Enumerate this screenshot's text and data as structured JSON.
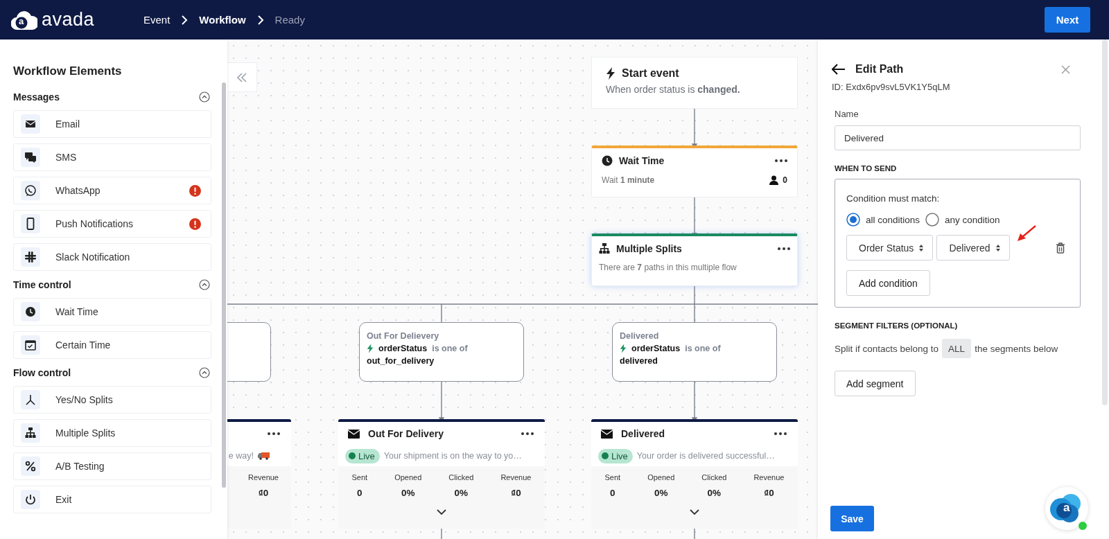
{
  "header": {
    "brand": "avada",
    "logo_letter": "a",
    "breadcrumb": [
      {
        "label": "Event",
        "selected": false,
        "disabled": false
      },
      {
        "label": "Workflow",
        "selected": true,
        "disabled": false
      },
      {
        "label": "Ready",
        "selected": false,
        "disabled": true
      }
    ],
    "next_button": "Next"
  },
  "sidebar": {
    "title": "Workflow Elements",
    "sections": [
      {
        "title": "Messages",
        "expanded": true,
        "items": [
          {
            "label": "Email",
            "kind": "email",
            "warning": false
          },
          {
            "label": "SMS",
            "kind": "sms",
            "warning": false
          },
          {
            "label": "WhatsApp",
            "kind": "whatsapp",
            "warning": true
          },
          {
            "label": "Push Notifications",
            "kind": "push",
            "warning": true
          },
          {
            "label": "Slack Notification",
            "kind": "slack",
            "warning": false
          }
        ]
      },
      {
        "title": "Time control",
        "expanded": true,
        "items": [
          {
            "label": "Wait Time",
            "kind": "wait",
            "warning": false
          },
          {
            "label": "Certain Time",
            "kind": "certain",
            "warning": false
          }
        ]
      },
      {
        "title": "Flow control",
        "expanded": true,
        "items": [
          {
            "label": "Yes/No Splits",
            "kind": "yesno",
            "warning": false
          },
          {
            "label": "Multiple Splits",
            "kind": "multi",
            "warning": false
          },
          {
            "label": "A/B Testing",
            "kind": "ab",
            "warning": false
          },
          {
            "label": "Exit",
            "kind": "exit",
            "warning": false
          }
        ]
      }
    ]
  },
  "canvas": {
    "start": {
      "title": "Start event",
      "text": "When order status is **changed.**"
    },
    "wait": {
      "title": "Wait Time",
      "text": "Wait **1 minute**",
      "count": "0"
    },
    "split": {
      "title": "Multiple Splits",
      "text": "There are **7** paths in this multiple flow"
    },
    "paths": [
      {
        "name": "Out For Delievery",
        "field": "orderStatus",
        "operator": "is one of",
        "value": "out_for_delivery"
      },
      {
        "name": "Delivered",
        "field": "orderStatus",
        "operator": "is one of",
        "value": "delivered"
      }
    ],
    "cut_message": {
      "preview": "e way!",
      "stats": [
        {
          "label": "Revenue",
          "value": "₫0"
        }
      ]
    },
    "messages": [
      {
        "title": "Out For Delivery",
        "status": "Live",
        "live": true,
        "preview": "Your shipment is on the way to yo…",
        "stats": [
          {
            "label": "Sent",
            "value": "0"
          },
          {
            "label": "Opened",
            "value": "0%"
          },
          {
            "label": "Clicked",
            "value": "0%"
          },
          {
            "label": "Revenue",
            "value": "₫0"
          }
        ]
      },
      {
        "title": "Delivered",
        "status": "Live",
        "live": true,
        "preview": "Your order is delivered successful…",
        "stats": [
          {
            "label": "Sent",
            "value": "0"
          },
          {
            "label": "Opened",
            "value": "0%"
          },
          {
            "label": "Clicked",
            "value": "0%"
          },
          {
            "label": "Revenue",
            "value": "₫0"
          }
        ]
      }
    ]
  },
  "panel": {
    "title": "Edit Path",
    "id_text": "ID: Exdx6pv9svL5VK1Y5qLM",
    "name_label": "Name",
    "name_value": "Delivered",
    "when_heading": "WHEN TO SEND",
    "match_label": "Condition must match:",
    "match_options": [
      {
        "label": "all conditions",
        "selected": true
      },
      {
        "label": "any condition",
        "selected": false
      }
    ],
    "conditions": [
      {
        "field": "Order Status",
        "value": "Delivered"
      }
    ],
    "add_condition": "Add condition",
    "segment_heading": "SEGMENT FILTERS (OPTIONAL)",
    "segment_before": "Split if contacts belong to",
    "segment_mode": "ALL",
    "segment_after": "the segments below",
    "add_segment": "Add segment",
    "save": "Save"
  },
  "chat_widget": {
    "letter": "a",
    "online": true
  }
}
